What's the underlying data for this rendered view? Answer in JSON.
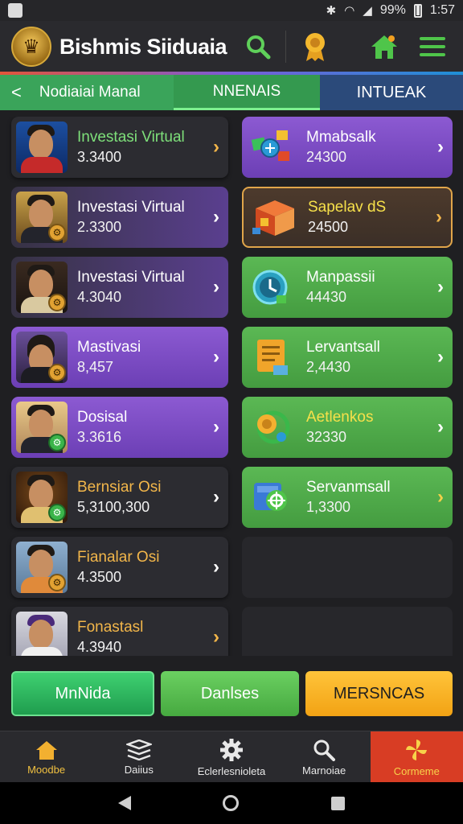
{
  "status": {
    "battery": "99%",
    "time": "1:57"
  },
  "app": {
    "title": "Bishmis Siiduaia"
  },
  "tabs": {
    "back_label": "Nodiaiai Manal",
    "middle": "NNENAIS",
    "right": "INTUEAK"
  },
  "left_cards": [
    {
      "title": "Investasi Virtual",
      "value": "3.3400",
      "title_color": "green"
    },
    {
      "title": "Investasi Virtual",
      "value": "2.3300",
      "title_color": "white"
    },
    {
      "title": "Investasi Virtual",
      "value": "4.3040",
      "title_color": "white"
    },
    {
      "title": "Mastivasi",
      "value": "8,457",
      "title_color": "white"
    },
    {
      "title": "Dosisal",
      "value": "3.3616",
      "title_color": "white"
    },
    {
      "title": "Bernsiar Osi",
      "value": "5,3100,300",
      "title_color": "gold"
    },
    {
      "title": "Fianalar Osi",
      "value": "4.3500",
      "title_color": "gold"
    },
    {
      "title": "Fonastasl",
      "value": "4.3940",
      "title_color": "gold"
    }
  ],
  "right_cards": [
    {
      "title": "Mmabsalk",
      "value": "24300"
    },
    {
      "title": "Sapelav dS",
      "value": "24500"
    },
    {
      "title": "Manpassii",
      "value": "44430"
    },
    {
      "title": "Lervantsall",
      "value": "2,4430"
    },
    {
      "title": "Aetlenkos",
      "value": "32330"
    },
    {
      "title": "Servanmsall",
      "value": "1,3300"
    }
  ],
  "actions": {
    "btn1": "MnNida",
    "btn2": "Danlses",
    "btn3": "MERSNCAS"
  },
  "bottom_nav": [
    {
      "label": "Moodbe",
      "icon": "home-icon"
    },
    {
      "label": "Daiius",
      "icon": "layers-icon"
    },
    {
      "label": "Eclerlesnioleta",
      "icon": "gear-icon"
    },
    {
      "label": "Marnoiae",
      "icon": "search-icon"
    },
    {
      "label": "Cormeme",
      "icon": "pinwheel-icon"
    }
  ],
  "colors": {
    "accent_green": "#3aa45a",
    "accent_purple": "#7b4dc7",
    "accent_gold": "#f2b64a",
    "accent_red": "#d83d24"
  }
}
